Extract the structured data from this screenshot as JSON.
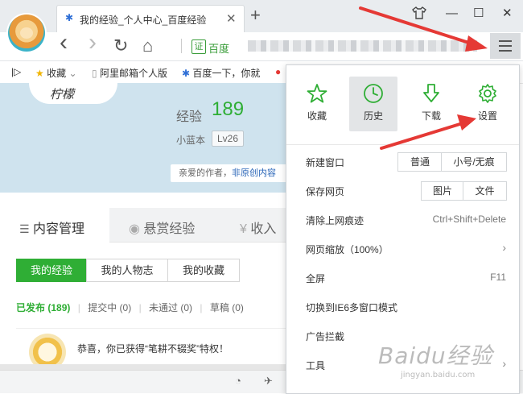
{
  "window": {
    "tab_title": "我的经验_个人中心_百度经验",
    "close_tab": "✕",
    "new_tab": "+",
    "controls": [
      "—",
      "☐",
      "✕"
    ]
  },
  "nav": {
    "back": "‹",
    "forward": "›",
    "reload": "↻",
    "home": "⌂",
    "cert_badge": "证",
    "cert_label": "百度"
  },
  "bookmarks": {
    "toggle": "|▷",
    "items": [
      "收藏",
      "阿里邮箱个人版",
      "百度一下，你就"
    ]
  },
  "profile": {
    "signature": "柠檬",
    "exp_label": "经验",
    "exp_value": "189",
    "rank_name": "小蓝本",
    "level": "Lv26",
    "notice_prefix": "亲爱的作者，",
    "notice_link": "非原创内容"
  },
  "page_tabs": [
    "内容管理",
    "悬赏经验",
    "收入"
  ],
  "sub_tabs": [
    "我的经验",
    "我的人物志",
    "我的收藏"
  ],
  "filters": [
    {
      "label": "已发布",
      "count": "(189)"
    },
    {
      "label": "提交中",
      "count": "(0)"
    },
    {
      "label": "未通过",
      "count": "(0)"
    },
    {
      "label": "草稿",
      "count": "(0)"
    }
  ],
  "card": {
    "text": "恭喜，你已获得“笔耕不辍奖”特权！"
  },
  "menu": {
    "quick_actions": [
      {
        "label": "收藏",
        "icon": "star-icon"
      },
      {
        "label": "历史",
        "icon": "clock-icon"
      },
      {
        "label": "下载",
        "icon": "download-icon"
      },
      {
        "label": "设置",
        "icon": "gear-icon"
      }
    ],
    "new_window": {
      "label": "新建窗口",
      "opt1": "普通",
      "opt2": "小号/无痕"
    },
    "save_page": {
      "label": "保存网页",
      "opt1": "图片",
      "opt2": "文件"
    },
    "clear_traces": {
      "label": "清除上网痕迹",
      "shortcut": "Ctrl+Shift+Delete"
    },
    "zoom": {
      "label": "网页缩放（100%）",
      "chevron": "›"
    },
    "fullscreen": {
      "label": "全屏",
      "shortcut": "F11"
    },
    "ie6_mode": {
      "label": "切换到IE6多窗口模式"
    },
    "ad_block": {
      "label": "广告拦截"
    },
    "tools": {
      "label": "工具",
      "chevron": "›"
    }
  },
  "watermark": {
    "big": "Baidu经验",
    "small": "jingyan.baidu.com"
  },
  "colors": {
    "accent_green": "#2fae35",
    "arrow_red": "#e53935",
    "hero_blue": "#cfe3ee"
  }
}
